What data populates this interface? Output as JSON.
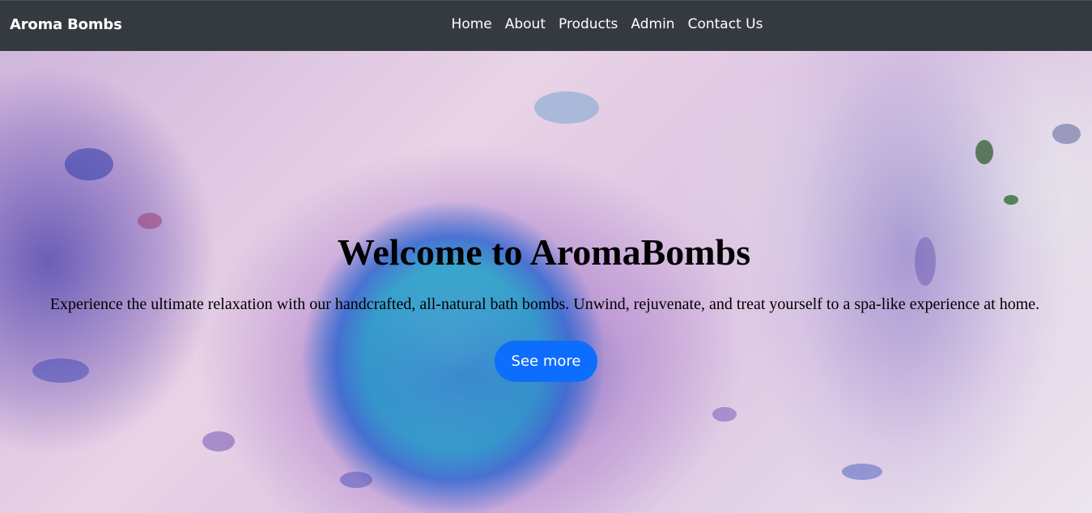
{
  "navbar": {
    "brand": "Aroma Bombs",
    "links": [
      "Home",
      "About",
      "Products",
      "Admin",
      "Contact Us"
    ]
  },
  "hero": {
    "title": "Welcome to AromaBombs",
    "text": "Experience the ultimate relaxation with our handcrafted, all-natural bath bombs. Unwind, rejuvenate, and treat yourself to a spa-like experience at home.",
    "button_label": "See more",
    "background_image": "bath-bomb-fizzing-image"
  },
  "colors": {
    "navbar_bg": "#343a40",
    "button_bg": "#0d6efd",
    "text_light": "#ffffff",
    "text_dark": "#000000"
  }
}
